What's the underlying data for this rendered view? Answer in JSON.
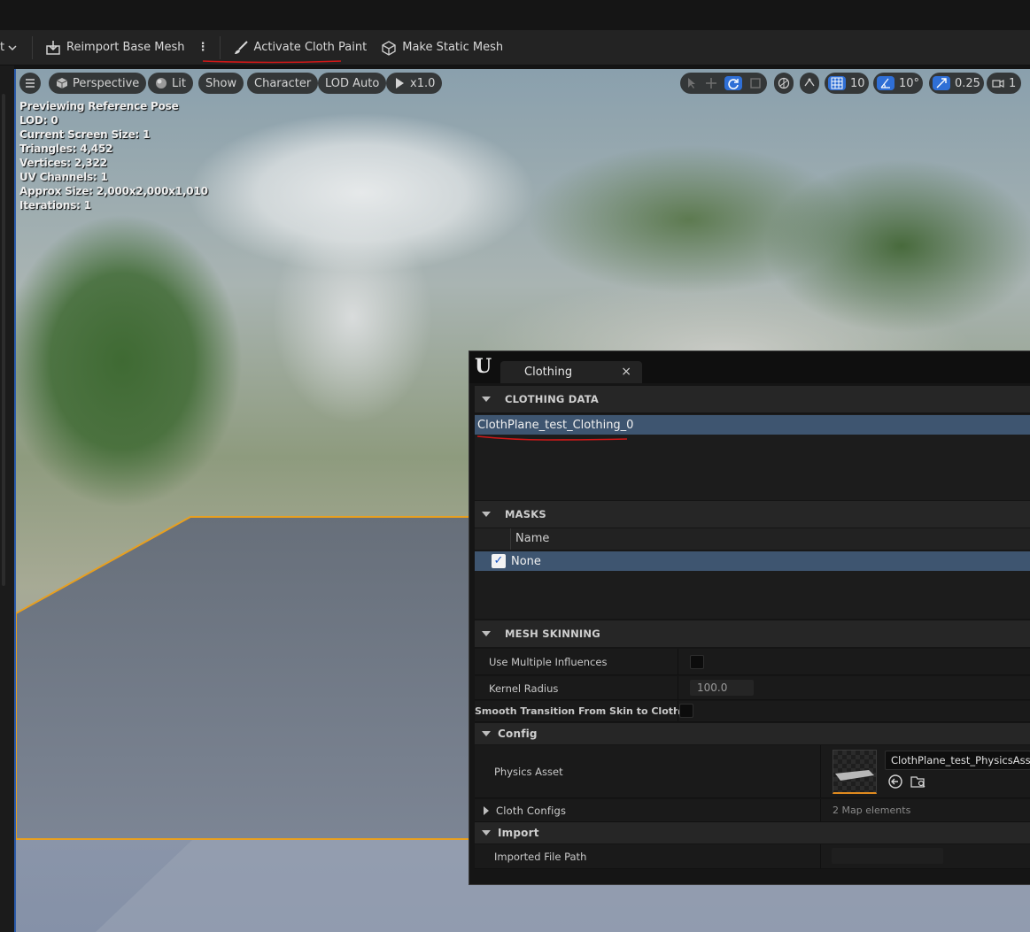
{
  "toolbar": {
    "truncated_label": "t",
    "reimport_label": "Reimport Base Mesh",
    "activate_cloth_label": "Activate Cloth Paint",
    "make_static_label": "Make Static Mesh"
  },
  "viewport": {
    "menu_icon": "hamburger-icon",
    "perspective_label": "Perspective",
    "lit_label": "Lit",
    "show_label": "Show",
    "character_label": "Character",
    "lod_label": "LOD Auto",
    "speed_label": "x1.0",
    "grid_value": "10",
    "angle_value": "10°",
    "scale_value": "0.25",
    "camera_value": "1",
    "stats": [
      "Previewing Reference Pose",
      "LOD: 0",
      "Current Screen Size: 1",
      "Triangles: 4,452",
      "Vertices: 2,322",
      "UV Channels: 1",
      "Approx Size: 2,000x2,000x1,010",
      "Iterations: 1"
    ],
    "selection_outline_color": "#e8a020"
  },
  "panel": {
    "tab_label": "Clothing",
    "close_glyph": "×",
    "clothing_data": {
      "header": "CLOTHING DATA",
      "selected_item": "ClothPlane_test_Clothing_0"
    },
    "masks": {
      "header": "MASKS",
      "column_name": "Name",
      "rows": [
        {
          "name": "None",
          "checked": true
        }
      ]
    },
    "mesh_skinning": {
      "header": "MESH SKINNING",
      "use_multiple_influences_label": "Use Multiple Influences",
      "use_multiple_influences": false,
      "kernel_radius_label": "Kernel Radius",
      "kernel_radius_value": "100.0",
      "smooth_transition_label": "Smooth Transition From Skin to Cloth",
      "smooth_transition": false
    },
    "config": {
      "header": "Config",
      "physics_asset_label": "Physics Asset",
      "physics_asset_value": "ClothPlane_test_PhysicsAsset",
      "cloth_configs_label": "Cloth Configs",
      "cloth_configs_value": "2 Map elements"
    },
    "import": {
      "header": "Import",
      "imported_file_path_label": "Imported File Path",
      "imported_file_path_value": ""
    }
  },
  "annotations": {
    "underline_color": "#d01818"
  }
}
